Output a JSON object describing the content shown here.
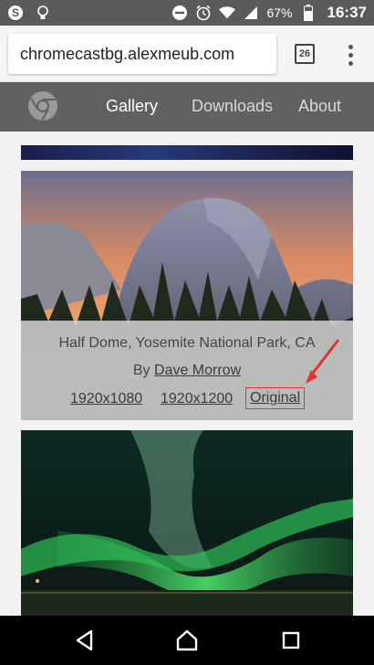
{
  "status_bar": {
    "battery": "67%",
    "time": "16:37"
  },
  "browser": {
    "url": "chromecastbg.alexmeub.com",
    "tab_count": "26"
  },
  "site_nav": {
    "items": [
      {
        "label": "Gallery",
        "active": true
      },
      {
        "label": "Downloads",
        "active": false
      },
      {
        "label": "About",
        "active": false
      }
    ]
  },
  "gallery": {
    "card1": {
      "title": "Half Dome, Yosemite National Park, CA",
      "by_prefix": "By",
      "author": "Dave Morrow",
      "resolutions": [
        "1920x1080",
        "1920x1200",
        "Original"
      ],
      "highlight_color": "#e33333"
    }
  }
}
